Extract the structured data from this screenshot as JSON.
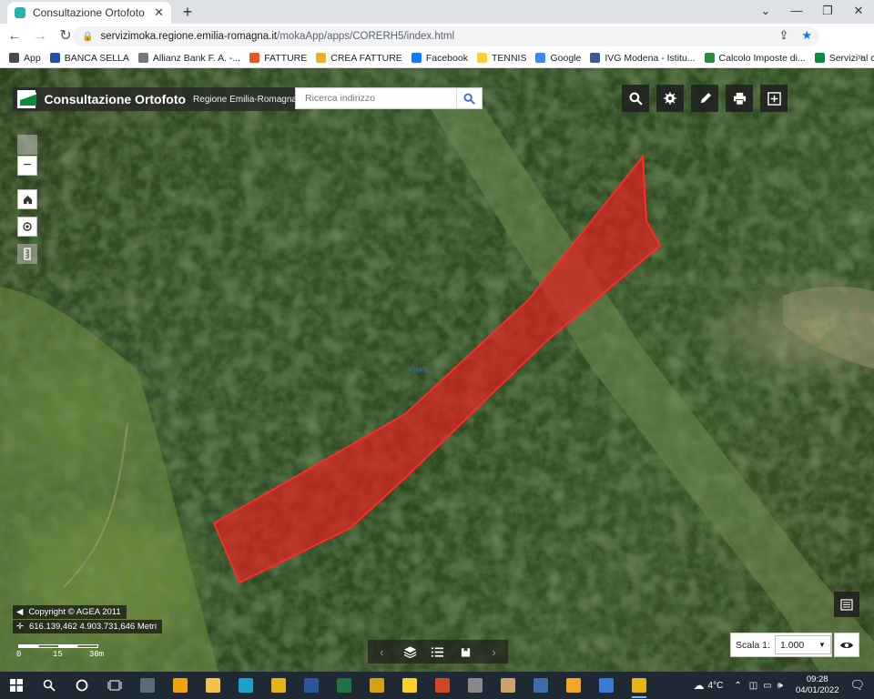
{
  "browser": {
    "tab_title": "Consultazione Ortofoto",
    "tab_close": "✕",
    "new_tab": "+",
    "url_host": "servizimoka.regione.emilia-romagna.it",
    "url_path": "/mokaApp/apps/CORERH5/index.html",
    "window_controls": [
      "⌄",
      "—",
      "❐",
      "✕"
    ]
  },
  "bookmarks": [
    {
      "label": "App",
      "color": "#4a4a4a"
    },
    {
      "label": "BANCA SELLA",
      "color": "#1f4fa6"
    },
    {
      "label": "Allianz Bank F. A. -...",
      "color": "#777777"
    },
    {
      "label": "FATTURE",
      "color": "#e0562a"
    },
    {
      "label": "CREA FATTURE",
      "color": "#e6b422"
    },
    {
      "label": "Facebook",
      "color": "#1877f2"
    },
    {
      "label": "TENNIS",
      "color": "#f4d03f"
    },
    {
      "label": "Google",
      "color": "#4285f4"
    },
    {
      "label": "IVG Modena - Istitu...",
      "color": "#3b5998"
    },
    {
      "label": "Calcolo Imposte di...",
      "color": "#2e8b3a"
    },
    {
      "label": "Servizi al cittadino...",
      "color": "#0e8a3e"
    }
  ],
  "app": {
    "title": "Consultazione Ortofoto",
    "subtitle": "Regione Emilia-Romagna",
    "search_placeholder": "Ricerca indirizzo"
  },
  "map": {
    "copyright": "Copyright © AGEA 2011",
    "coordinates": "616.139,462 4.903.731,646 Metri",
    "scale_labels": [
      "0",
      "15",
      "30m"
    ],
    "scale_prefix": "Scala 1:",
    "scale_value": "1.000",
    "marker_label": "WMS"
  },
  "taskbar": {
    "temperature": "4°C",
    "time": "09:28",
    "date": "04/01/2022",
    "apps": [
      {
        "name": "calculator",
        "color": "#5a6b7c"
      },
      {
        "name": "outlook",
        "color": "#f0a30a"
      },
      {
        "name": "file-explorer",
        "color": "#f2c14e"
      },
      {
        "name": "edge",
        "color": "#1da1c8"
      },
      {
        "name": "chrome",
        "color": "#e7b416"
      },
      {
        "name": "word",
        "color": "#2b579a"
      },
      {
        "name": "excel",
        "color": "#217346"
      },
      {
        "name": "media",
        "color": "#d4a017"
      },
      {
        "name": "sticky",
        "color": "#f7d02c"
      },
      {
        "name": "powerpoint",
        "color": "#d24726"
      },
      {
        "name": "game",
        "color": "#888888"
      },
      {
        "name": "paint",
        "color": "#c8a46e"
      },
      {
        "name": "notepad",
        "color": "#3b6ea5"
      },
      {
        "name": "store",
        "color": "#f5a623"
      },
      {
        "name": "sign",
        "color": "#3a7bd5"
      },
      {
        "name": "chrome-active",
        "color": "#e7b416"
      }
    ]
  }
}
